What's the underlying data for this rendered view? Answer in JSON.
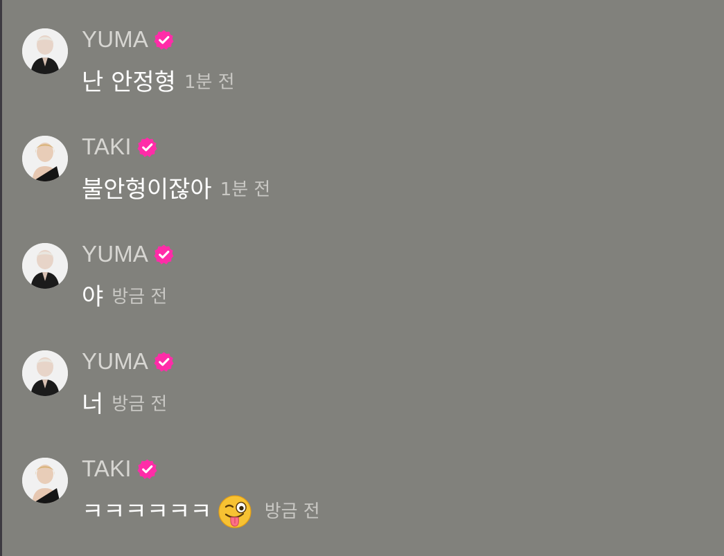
{
  "chat": {
    "messages": [
      {
        "author": "YUMA",
        "verified": true,
        "avatar": "yuma-avatar",
        "text": "난 안정형",
        "time": "1분 전"
      },
      {
        "author": "TAKI",
        "verified": true,
        "avatar": "taki-avatar",
        "text": "불안형이잖아",
        "time": "1분 전"
      },
      {
        "author": "YUMA",
        "verified": true,
        "avatar": "yuma-avatar",
        "text": "야",
        "time": "방금 전"
      },
      {
        "author": "YUMA",
        "verified": true,
        "avatar": "yuma-avatar",
        "text": "너",
        "time": "방금 전"
      },
      {
        "author": "TAKI",
        "verified": true,
        "avatar": "taki-avatar",
        "text": "ㅋㅋㅋㅋㅋㅋ",
        "emoji": "winking-face-with-tongue",
        "time": "방금 전"
      }
    ]
  },
  "colors": {
    "background": "#81817c",
    "name_text": "#d7d6d2",
    "message_text": "#ffffff",
    "time_text": "#c9c8c4",
    "badge": "#ff2ca8",
    "left_edge": "#3d3a41"
  },
  "icons": {
    "verified": "verified-badge-icon",
    "emoji": "winking-face-with-tongue-emoji"
  }
}
